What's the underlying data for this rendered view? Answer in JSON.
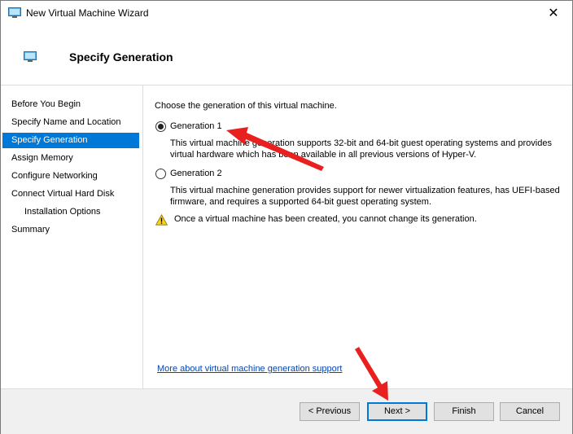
{
  "window": {
    "title": "New Virtual Machine Wizard",
    "close_glyph": "✕"
  },
  "header": {
    "title": "Specify Generation"
  },
  "nav": {
    "items": [
      {
        "label": "Before You Begin"
      },
      {
        "label": "Specify Name and Location"
      },
      {
        "label": "Specify Generation",
        "selected": true
      },
      {
        "label": "Assign Memory"
      },
      {
        "label": "Configure Networking"
      },
      {
        "label": "Connect Virtual Hard Disk"
      },
      {
        "label": "Installation Options",
        "indent": true
      },
      {
        "label": "Summary"
      }
    ]
  },
  "main": {
    "intro": "Choose the generation of this virtual machine.",
    "gen1": {
      "label": "Generation 1",
      "selected": true,
      "desc_line1": "This virtual machine generation supports 32-bit and 64-bit guest operating systems and provides",
      "desc_line2": "virtual hardware which has been available in all previous versions of Hyper-V."
    },
    "gen2": {
      "label": "Generation 2",
      "selected": false,
      "desc_line1": "This virtual machine generation provides support for newer virtualization features, has UEFI-based",
      "desc_line2": "firmware, and requires a supported 64-bit guest operating system."
    },
    "warning": "Once a virtual machine has been created, you cannot change its generation.",
    "more_link": "More about virtual machine generation support"
  },
  "footer": {
    "previous_label": "< Previous",
    "next_label": "Next >",
    "finish_label": "Finish",
    "cancel_label": "Cancel"
  },
  "colors": {
    "selection": "#0078d7",
    "annotation_arrow": "#e8201f",
    "link": "#0645ad"
  }
}
